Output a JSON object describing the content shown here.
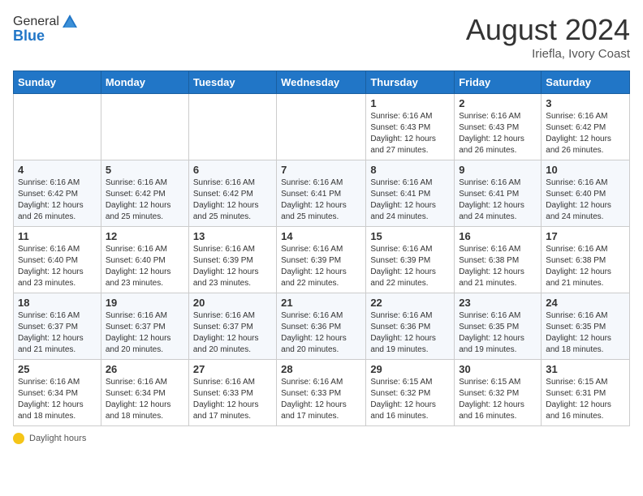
{
  "header": {
    "logo_line1": "General",
    "logo_line2": "Blue",
    "title": "August 2024",
    "subtitle": "Iriefla, Ivory Coast"
  },
  "weekdays": [
    "Sunday",
    "Monday",
    "Tuesday",
    "Wednesday",
    "Thursday",
    "Friday",
    "Saturday"
  ],
  "footer": {
    "label": "Daylight hours"
  },
  "weeks": [
    [
      {
        "day": "",
        "info": ""
      },
      {
        "day": "",
        "info": ""
      },
      {
        "day": "",
        "info": ""
      },
      {
        "day": "",
        "info": ""
      },
      {
        "day": "1",
        "info": "Sunrise: 6:16 AM\nSunset: 6:43 PM\nDaylight: 12 hours and 27 minutes."
      },
      {
        "day": "2",
        "info": "Sunrise: 6:16 AM\nSunset: 6:43 PM\nDaylight: 12 hours and 26 minutes."
      },
      {
        "day": "3",
        "info": "Sunrise: 6:16 AM\nSunset: 6:42 PM\nDaylight: 12 hours and 26 minutes."
      }
    ],
    [
      {
        "day": "4",
        "info": "Sunrise: 6:16 AM\nSunset: 6:42 PM\nDaylight: 12 hours and 26 minutes."
      },
      {
        "day": "5",
        "info": "Sunrise: 6:16 AM\nSunset: 6:42 PM\nDaylight: 12 hours and 25 minutes."
      },
      {
        "day": "6",
        "info": "Sunrise: 6:16 AM\nSunset: 6:42 PM\nDaylight: 12 hours and 25 minutes."
      },
      {
        "day": "7",
        "info": "Sunrise: 6:16 AM\nSunset: 6:41 PM\nDaylight: 12 hours and 25 minutes."
      },
      {
        "day": "8",
        "info": "Sunrise: 6:16 AM\nSunset: 6:41 PM\nDaylight: 12 hours and 24 minutes."
      },
      {
        "day": "9",
        "info": "Sunrise: 6:16 AM\nSunset: 6:41 PM\nDaylight: 12 hours and 24 minutes."
      },
      {
        "day": "10",
        "info": "Sunrise: 6:16 AM\nSunset: 6:40 PM\nDaylight: 12 hours and 24 minutes."
      }
    ],
    [
      {
        "day": "11",
        "info": "Sunrise: 6:16 AM\nSunset: 6:40 PM\nDaylight: 12 hours and 23 minutes."
      },
      {
        "day": "12",
        "info": "Sunrise: 6:16 AM\nSunset: 6:40 PM\nDaylight: 12 hours and 23 minutes."
      },
      {
        "day": "13",
        "info": "Sunrise: 6:16 AM\nSunset: 6:39 PM\nDaylight: 12 hours and 23 minutes."
      },
      {
        "day": "14",
        "info": "Sunrise: 6:16 AM\nSunset: 6:39 PM\nDaylight: 12 hours and 22 minutes."
      },
      {
        "day": "15",
        "info": "Sunrise: 6:16 AM\nSunset: 6:39 PM\nDaylight: 12 hours and 22 minutes."
      },
      {
        "day": "16",
        "info": "Sunrise: 6:16 AM\nSunset: 6:38 PM\nDaylight: 12 hours and 21 minutes."
      },
      {
        "day": "17",
        "info": "Sunrise: 6:16 AM\nSunset: 6:38 PM\nDaylight: 12 hours and 21 minutes."
      }
    ],
    [
      {
        "day": "18",
        "info": "Sunrise: 6:16 AM\nSunset: 6:37 PM\nDaylight: 12 hours and 21 minutes."
      },
      {
        "day": "19",
        "info": "Sunrise: 6:16 AM\nSunset: 6:37 PM\nDaylight: 12 hours and 20 minutes."
      },
      {
        "day": "20",
        "info": "Sunrise: 6:16 AM\nSunset: 6:37 PM\nDaylight: 12 hours and 20 minutes."
      },
      {
        "day": "21",
        "info": "Sunrise: 6:16 AM\nSunset: 6:36 PM\nDaylight: 12 hours and 20 minutes."
      },
      {
        "day": "22",
        "info": "Sunrise: 6:16 AM\nSunset: 6:36 PM\nDaylight: 12 hours and 19 minutes."
      },
      {
        "day": "23",
        "info": "Sunrise: 6:16 AM\nSunset: 6:35 PM\nDaylight: 12 hours and 19 minutes."
      },
      {
        "day": "24",
        "info": "Sunrise: 6:16 AM\nSunset: 6:35 PM\nDaylight: 12 hours and 18 minutes."
      }
    ],
    [
      {
        "day": "25",
        "info": "Sunrise: 6:16 AM\nSunset: 6:34 PM\nDaylight: 12 hours and 18 minutes."
      },
      {
        "day": "26",
        "info": "Sunrise: 6:16 AM\nSunset: 6:34 PM\nDaylight: 12 hours and 18 minutes."
      },
      {
        "day": "27",
        "info": "Sunrise: 6:16 AM\nSunset: 6:33 PM\nDaylight: 12 hours and 17 minutes."
      },
      {
        "day": "28",
        "info": "Sunrise: 6:16 AM\nSunset: 6:33 PM\nDaylight: 12 hours and 17 minutes."
      },
      {
        "day": "29",
        "info": "Sunrise: 6:15 AM\nSunset: 6:32 PM\nDaylight: 12 hours and 16 minutes."
      },
      {
        "day": "30",
        "info": "Sunrise: 6:15 AM\nSunset: 6:32 PM\nDaylight: 12 hours and 16 minutes."
      },
      {
        "day": "31",
        "info": "Sunrise: 6:15 AM\nSunset: 6:31 PM\nDaylight: 12 hours and 16 minutes."
      }
    ]
  ]
}
